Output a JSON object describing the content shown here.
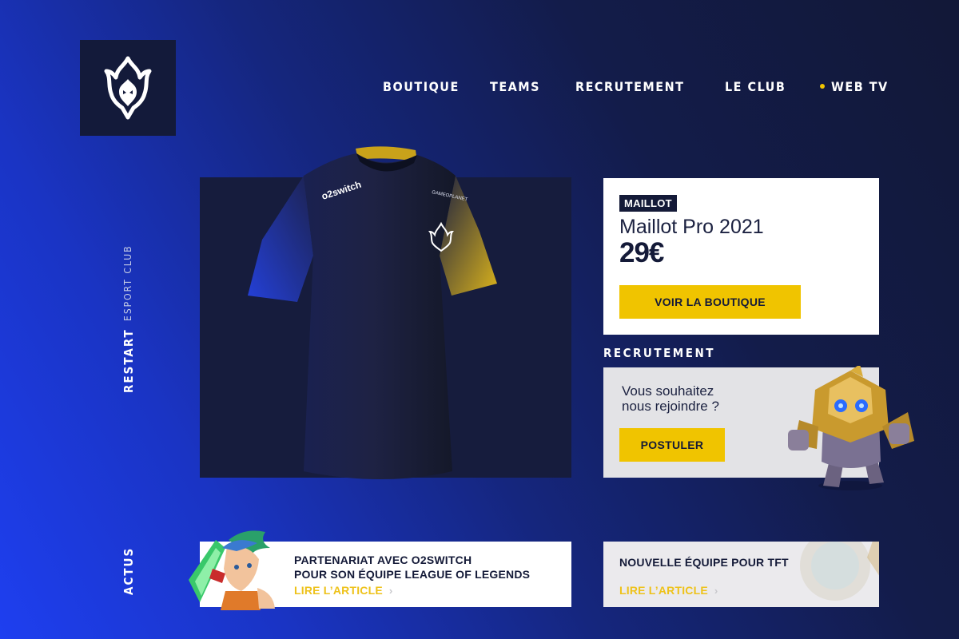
{
  "nav": {
    "items": [
      "BOUTIQUE",
      "TEAMS",
      "RECRUTEMENT",
      "LE CLUB"
    ],
    "webtv": "WEB TV"
  },
  "side": {
    "brand": "RESTART",
    "tagline": "ESPORT CLUB",
    "news_label": "ACTUS"
  },
  "product": {
    "badge": "MAILLOT",
    "name": "Maillot Pro 2021",
    "price": "29€",
    "cta": "VOIR LA BOUTIQUE",
    "jersey_sponsor_left": "o2switch",
    "jersey_sponsor_right": "GAMEOPLANET"
  },
  "recruit": {
    "title": "RECRUTEMENT",
    "text_line1": "Vous souhaitez",
    "text_line2": "nous rejoindre ?",
    "cta": "POSTULER"
  },
  "news": [
    {
      "title_line1": "PARTENARIAT AVEC O2SWITCH",
      "title_line2": "POUR SON ÉQUIPE LEAGUE OF LEGENDS",
      "link": "LIRE L’ARTICLE"
    },
    {
      "title_line1": "NOUVELLE ÉQUIPE POUR TFT",
      "link": "LIRE L’ARTICLE"
    }
  ],
  "colors": {
    "accent": "#f0c400",
    "navy": "#141a38",
    "blue": "#1e3ff0"
  },
  "icons": [
    "phoenix-logo-icon",
    "live-dot-icon",
    "chevron-right-icon"
  ]
}
